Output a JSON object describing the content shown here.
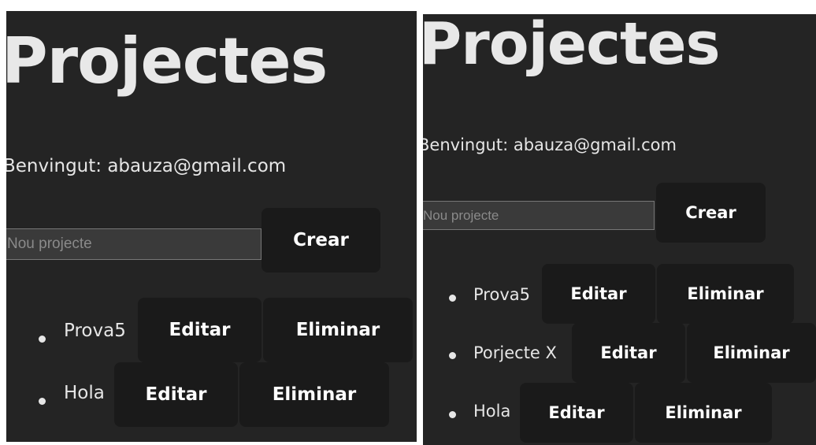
{
  "screens": [
    {
      "title": "Projectes",
      "welcome": "Benvingut: abauza@gmail.com",
      "new_project_placeholder": "Nou projecte",
      "create_label": "Crear",
      "projects": [
        {
          "name": "Prova5",
          "edit_label": "Editar",
          "delete_label": "Eliminar"
        },
        {
          "name": "Hola",
          "edit_label": "Editar",
          "delete_label": "Eliminar"
        }
      ]
    },
    {
      "title": "Projectes",
      "welcome": "Benvingut: abauza@gmail.com",
      "new_project_placeholder": "Nou projecte",
      "create_label": "Crear",
      "projects": [
        {
          "name": "Prova5",
          "edit_label": "Editar",
          "delete_label": "Eliminar"
        },
        {
          "name": "Porjecte X",
          "edit_label": "Editar",
          "delete_label": "Eliminar"
        },
        {
          "name": "Hola",
          "edit_label": "Editar",
          "delete_label": "Eliminar"
        }
      ]
    }
  ]
}
